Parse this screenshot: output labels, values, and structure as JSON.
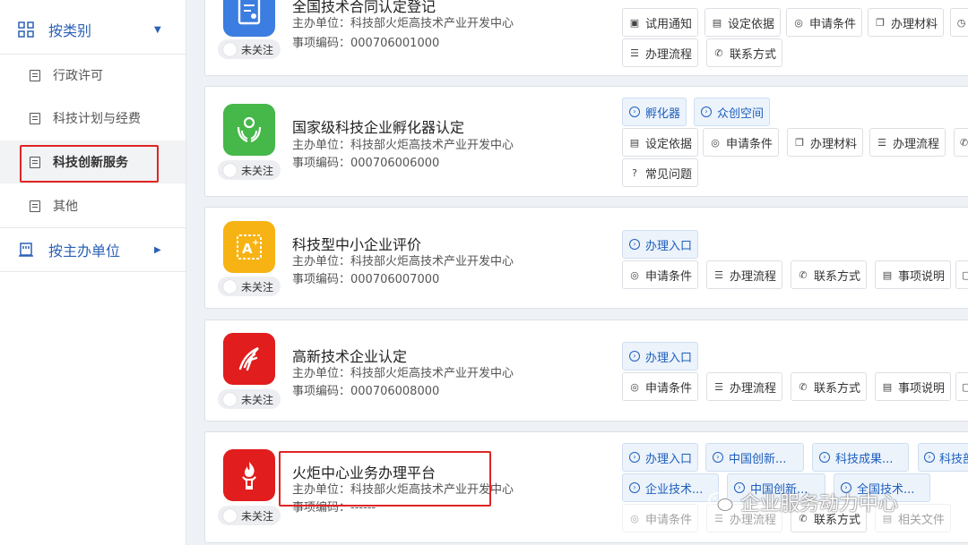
{
  "sidebar": {
    "group1": "按类别",
    "items": [
      "行政许可",
      "科技计划与经费",
      "科技创新服务",
      "其他"
    ],
    "group2": "按主办单位"
  },
  "follow_label": "未关注",
  "cards": [
    {
      "title": "全国技术合同认定登记",
      "org": "主办单位：科技部火炬高技术产业开发中心",
      "code": "事项编码：000706001000",
      "buttons_row1": [
        "试用通知",
        "设定依据",
        "申请条件",
        "办理材料"
      ],
      "buttons_row2": [
        "办理流程",
        "联系方式"
      ]
    },
    {
      "title": "国家级科技企业孵化器认定",
      "org": "主办单位：科技部火炬高技术产业开发中心",
      "code": "事项编码：000706006000",
      "buttons_row1": [
        "孵化器",
        "众创空间"
      ],
      "buttons_row2": [
        "设定依据",
        "申请条件",
        "办理材料",
        "办理流程"
      ],
      "buttons_row3": [
        "常见问题"
      ]
    },
    {
      "title": "科技型中小企业评价",
      "org": "主办单位：科技部火炬高技术产业开发中心",
      "code": "事项编码：000706007000",
      "buttons_row1": [
        "办理入口"
      ],
      "buttons_row2": [
        "申请条件",
        "办理流程",
        "联系方式",
        "事项说明"
      ]
    },
    {
      "title": "高新技术企业认定",
      "org": "主办单位：科技部火炬高技术产业开发中心",
      "code": "事项编码：000706008000",
      "buttons_row1": [
        "办理入口"
      ],
      "buttons_row2": [
        "申请条件",
        "办理流程",
        "联系方式",
        "事项说明"
      ]
    },
    {
      "title": "火炬中心业务办理平台",
      "org": "主办单位：科技部火炬高技术产业开发中心",
      "code": "事项编码：------",
      "buttons_row1": [
        "办理入口",
        "中国创新...",
        "科技成果...",
        "科技部"
      ],
      "buttons_row2": [
        "企业技术...",
        "中国创新...",
        "全国技术..."
      ],
      "buttons_row3": [
        "申请条件",
        "办理流程",
        "联系方式",
        "相关文件"
      ]
    }
  ],
  "watermark": "企业服务动力中心",
  "colors": {
    "accent": "#2c61b6",
    "highlight_red": "#e02424",
    "icon_blue": "#3b7de0",
    "icon_green": "#46b749",
    "icon_yellow": "#f6b313",
    "icon_red": "#e21d1d"
  }
}
